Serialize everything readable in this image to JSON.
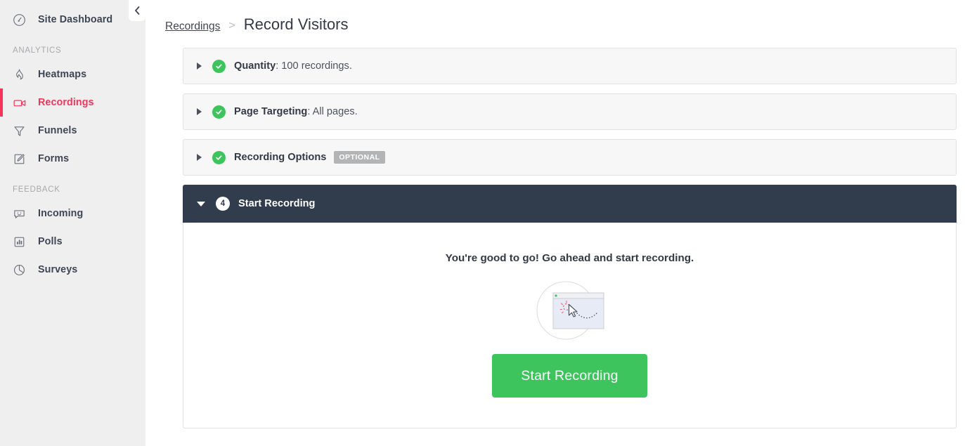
{
  "sidebar": {
    "collapse_icon": "chevron-left-icon",
    "top_items": [
      {
        "label": "Site Dashboard",
        "icon": "gauge-icon",
        "active": false
      }
    ],
    "groups": [
      {
        "title": "ANALYTICS",
        "items": [
          {
            "label": "Heatmaps",
            "icon": "flame-icon",
            "active": false
          },
          {
            "label": "Recordings",
            "icon": "video-camera-icon",
            "active": true
          },
          {
            "label": "Funnels",
            "icon": "funnel-icon",
            "active": false
          },
          {
            "label": "Forms",
            "icon": "form-pencil-icon",
            "active": false
          }
        ]
      },
      {
        "title": "FEEDBACK",
        "items": [
          {
            "label": "Incoming",
            "icon": "smiley-box-icon",
            "active": false
          },
          {
            "label": "Polls",
            "icon": "bar-chart-icon",
            "active": false
          },
          {
            "label": "Surveys",
            "icon": "pie-chart-icon",
            "active": false
          }
        ]
      }
    ],
    "active_color": "#f8345a",
    "background": "#efeff0"
  },
  "breadcrumb": {
    "parent": "Recordings",
    "separator": ">",
    "current": "Record Visitors"
  },
  "steps": [
    {
      "title": "Quantity",
      "subtitle": " : 100 recordings.",
      "state": "complete",
      "optional": false,
      "expanded": false
    },
    {
      "title": "Page Targeting",
      "subtitle": ": All pages.",
      "state": "complete",
      "optional": false,
      "expanded": false
    },
    {
      "title": "Recording Options",
      "subtitle": "",
      "state": "complete",
      "optional": true,
      "optional_label": "OPTIONAL",
      "expanded": false
    }
  ],
  "active_step": {
    "number": "4",
    "title": "Start Recording",
    "expanded": true,
    "body": {
      "headline": "You're good to go! Go ahead and start recording.",
      "illustration": "browser-cursor-path-illustration",
      "cta_label": "Start Recording"
    }
  },
  "colors": {
    "accent_green": "#3ec45c",
    "accent_red": "#f8345a",
    "dark_panel": "#313d4c",
    "panel_bg": "#f7f7f8",
    "panel_border": "#e0e2e5",
    "badge_gray": "#b3b4b6"
  }
}
